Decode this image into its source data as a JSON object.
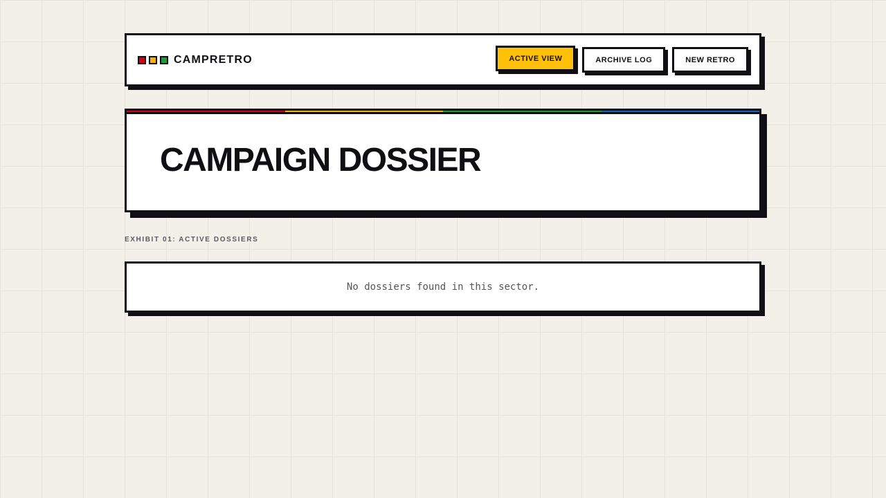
{
  "brand": {
    "name": "CAMPRETRO",
    "squares": [
      "#d0021b",
      "#f5b400",
      "#1e9b3a"
    ]
  },
  "nav": {
    "active_view": "ACTIVE VIEW",
    "archive_log": "ARCHIVE LOG",
    "new_retro": "NEW RETRO"
  },
  "hero": {
    "title": "CAMPAIGN DOSSIER",
    "stripe_colors": [
      "#d0021b",
      "#f5b400",
      "#1e9b3a",
      "#1565c0"
    ]
  },
  "section": {
    "label": "EXHIBIT 01: ACTIVE DOSSIERS"
  },
  "empty_state": {
    "message": "No dossiers found in this sector."
  },
  "colors": {
    "accent": "#ffc107",
    "ink": "#0f0f14",
    "background": "#f3f0ea"
  }
}
